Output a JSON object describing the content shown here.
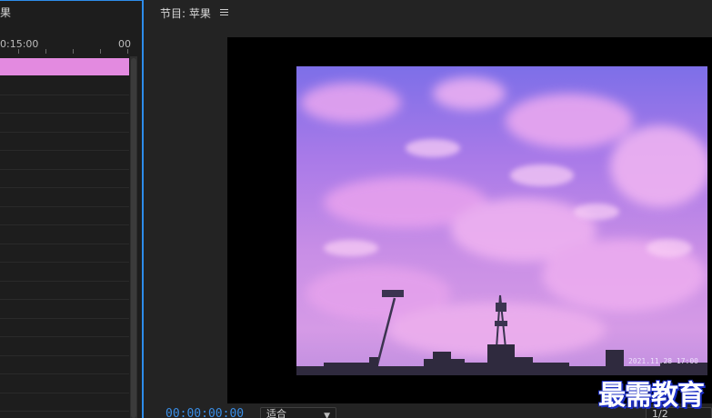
{
  "timeline": {
    "tab_label": "果",
    "ruler_ticks": [
      "0:15:00",
      "00"
    ],
    "clip_color": "#e38ae0"
  },
  "monitor": {
    "title": "节目: 苹果",
    "menu_icon": "hamburger-icon",
    "frame_stamp": "2021.11.28 17:00",
    "timecode": "00:00:00:00",
    "fit_label": "适合",
    "resolution_label": "1/2"
  },
  "watermark": {
    "text": "最需教育",
    "color": "#1d2fc4"
  },
  "colors": {
    "accent": "#2d8ceb",
    "timecode": "#3a8ee6",
    "panel_bg": "#232323"
  }
}
